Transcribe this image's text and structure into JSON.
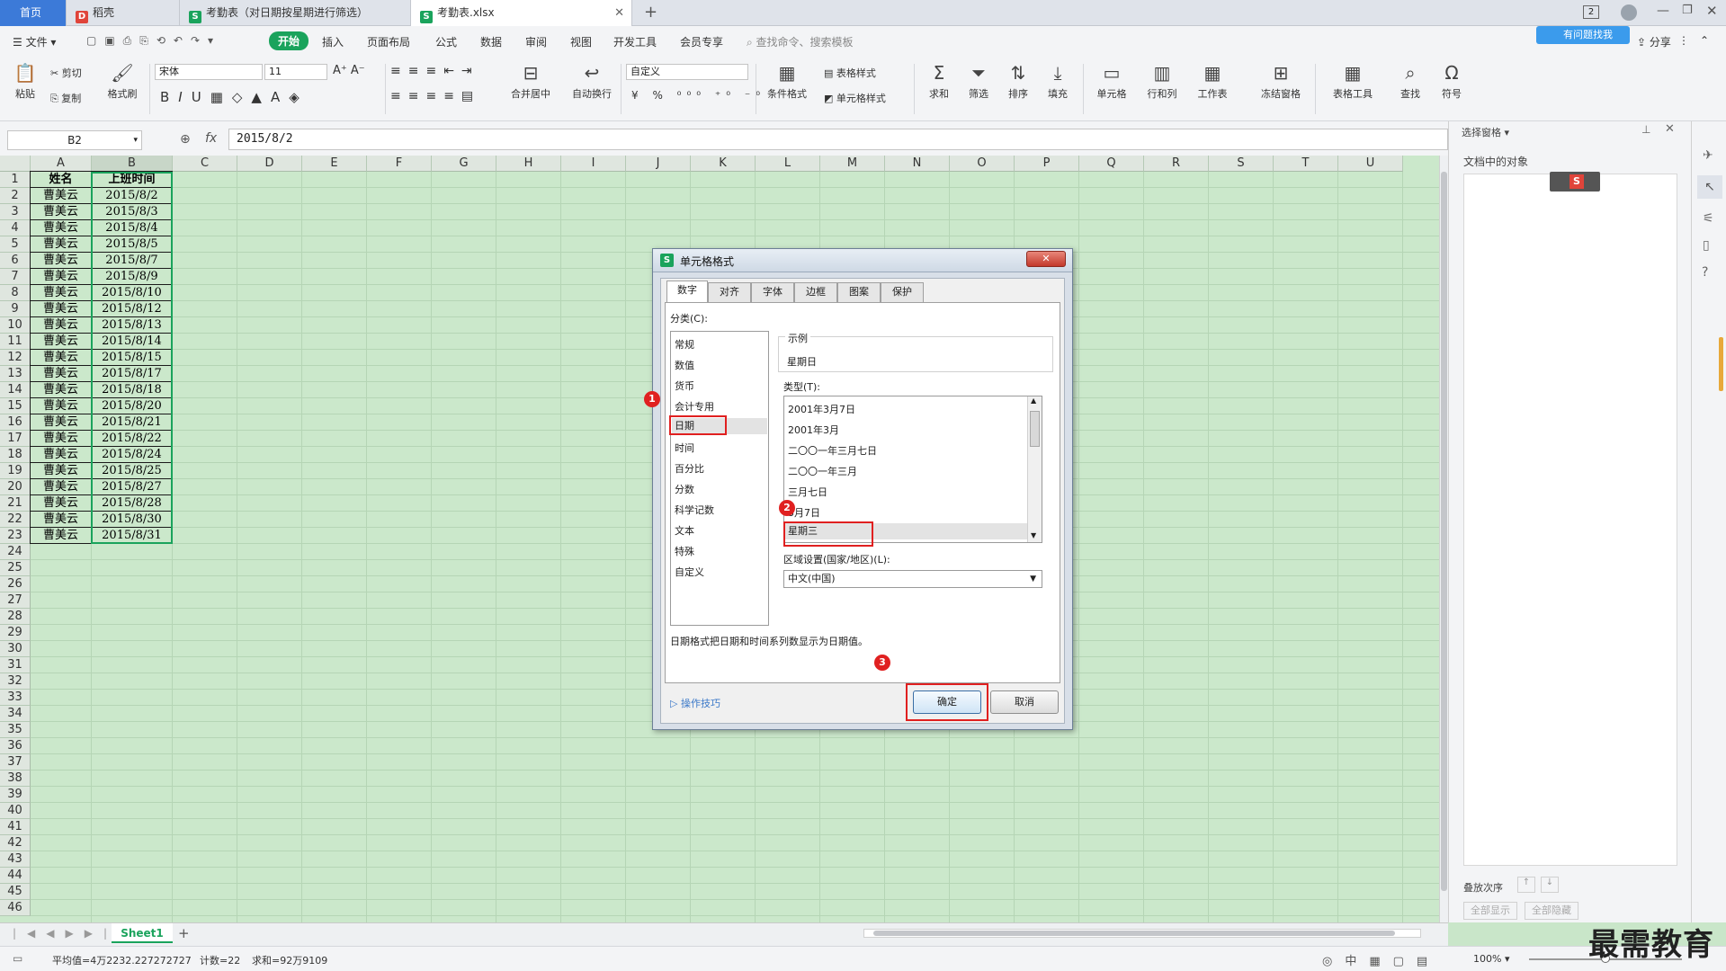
{
  "tabs": [
    {
      "label": "首页",
      "icon": ""
    },
    {
      "label": "稻壳",
      "icon": "D"
    },
    {
      "label": "考勤表（对日期按星期进行筛选）",
      "icon": "S"
    },
    {
      "label": "考勤表.xlsx",
      "icon": "S"
    }
  ],
  "topright": {
    "badge": "2",
    "promo": "有问题找我",
    "share": "分享"
  },
  "menu": {
    "file": "文件",
    "items": [
      "开始",
      "插入",
      "页面布局",
      "公式",
      "数据",
      "审阅",
      "视图",
      "开发工具",
      "会员专享"
    ],
    "search_placeholder": "查找命令、搜索模板"
  },
  "ribbon": {
    "paste": "粘贴",
    "cut": "剪切",
    "copy": "复制",
    "format_painter": "格式刷",
    "font_name": "宋体",
    "font_size": "11",
    "merge": "合并居中",
    "wrap": "自动换行",
    "number_format": "自定义",
    "cond_format": "条件格式",
    "table_style": "表格样式",
    "cell_style": "单元格样式",
    "sum": "求和",
    "filter": "筛选",
    "sort": "排序",
    "fill": "填充",
    "cell": "单元格",
    "row_col": "行和列",
    "worksheet": "工作表",
    "freeze": "冻结窗格",
    "table_tools": "表格工具",
    "find": "查找",
    "symbol": "符号"
  },
  "formula": {
    "name_box": "B2",
    "fx": "fx",
    "value": "2015/8/2"
  },
  "columns": [
    "A",
    "B",
    "C",
    "D",
    "E",
    "F",
    "G",
    "H",
    "I",
    "J",
    "K",
    "L",
    "M",
    "N",
    "O",
    "P",
    "Q",
    "R",
    "S",
    "T",
    "U"
  ],
  "header": {
    "name": "姓名",
    "time": "上班时间"
  },
  "rows": [
    {
      "name": "曹美云",
      "date": "2015/8/2"
    },
    {
      "name": "曹美云",
      "date": "2015/8/3"
    },
    {
      "name": "曹美云",
      "date": "2015/8/4"
    },
    {
      "name": "曹美云",
      "date": "2015/8/5"
    },
    {
      "name": "曹美云",
      "date": "2015/8/7"
    },
    {
      "name": "曹美云",
      "date": "2015/8/9"
    },
    {
      "name": "曹美云",
      "date": "2015/8/10"
    },
    {
      "name": "曹美云",
      "date": "2015/8/12"
    },
    {
      "name": "曹美云",
      "date": "2015/8/13"
    },
    {
      "name": "曹美云",
      "date": "2015/8/14"
    },
    {
      "name": "曹美云",
      "date": "2015/8/15"
    },
    {
      "name": "曹美云",
      "date": "2015/8/17"
    },
    {
      "name": "曹美云",
      "date": "2015/8/18"
    },
    {
      "name": "曹美云",
      "date": "2015/8/20"
    },
    {
      "name": "曹美云",
      "date": "2015/8/21"
    },
    {
      "name": "曹美云",
      "date": "2015/8/22"
    },
    {
      "name": "曹美云",
      "date": "2015/8/24"
    },
    {
      "name": "曹美云",
      "date": "2015/8/25"
    },
    {
      "name": "曹美云",
      "date": "2015/8/27"
    },
    {
      "name": "曹美云",
      "date": "2015/8/28"
    },
    {
      "name": "曹美云",
      "date": "2015/8/30"
    },
    {
      "name": "曹美云",
      "date": "2015/8/31"
    }
  ],
  "row_count": 46,
  "rightpane": {
    "title": "选择窗格",
    "objects": "文档中的对象",
    "order": "叠放次序",
    "show_all": "全部显示",
    "hide_all": "全部隐藏"
  },
  "sheet": {
    "name": "Sheet1"
  },
  "status": {
    "avg": "平均值=4万2232.227272727",
    "count": "计数=22",
    "sum": "求和=92万9109",
    "zoom": "100%",
    "watermark": "最需教育"
  },
  "dialog": {
    "title": "单元格格式",
    "tabs": [
      "数字",
      "对齐",
      "字体",
      "边框",
      "图案",
      "保护"
    ],
    "category_label": "分类(C):",
    "categories": [
      "常规",
      "数值",
      "货币",
      "会计专用",
      "日期",
      "时间",
      "百分比",
      "分数",
      "科学记数",
      "文本",
      "特殊",
      "自定义"
    ],
    "sample_label": "示例",
    "sample_value": "星期日",
    "type_label": "类型(T):",
    "types": [
      "2001年3月7日",
      "2001年3月",
      "二〇〇一年三月七日",
      "二〇〇一年三月",
      "三月七日",
      "3月7日",
      "星期三"
    ],
    "locale_label": "区域设置(国家/地区)(L):",
    "locale_value": "中文(中国)",
    "description": "日期格式把日期和时间系列数显示为日期值。",
    "tips": "操作技巧",
    "ok": "确定",
    "cancel": "取消",
    "markers": [
      "1",
      "2",
      "3"
    ]
  },
  "colors": {
    "accent": "#1aa35c",
    "marker": "#e02020",
    "grid_bg": "#cbe8cb"
  }
}
